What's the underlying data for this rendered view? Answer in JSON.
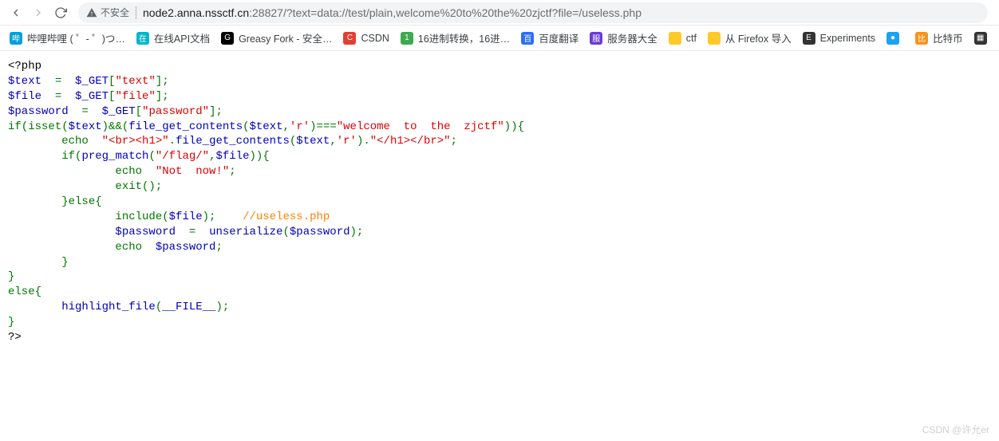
{
  "toolbar": {
    "insecure_label": "不安全",
    "url_host": "node2.anna.nssctf.cn",
    "url_port": ":28827",
    "url_path": "/?text=data://test/plain,welcome%20to%20the%20zjctf?file=/useless.php"
  },
  "bookmarks": [
    {
      "label": "哔哩哔哩 ( ゜- ゜)つ…",
      "color": "#00a1d6"
    },
    {
      "label": "在线API文档",
      "color": "#00b6c8"
    },
    {
      "label": "Greasy Fork - 安全…",
      "color": "#000"
    },
    {
      "label": "CSDN",
      "color": "#e33e33"
    },
    {
      "label": "16进制转换，16进…",
      "color": "#3daa4f"
    },
    {
      "label": "百度翻译",
      "color": "#2d6ff1"
    },
    {
      "label": "服务器大全",
      "color": "#6a3bd9"
    },
    {
      "label": "ctf",
      "folder": true
    },
    {
      "label": "从 Firefox 导入",
      "folder": true
    },
    {
      "label": "Experiments",
      "color": "#333"
    },
    {
      "label": "",
      "color": "#1da1f2"
    },
    {
      "label": "比特币",
      "color": "#f7931a"
    }
  ],
  "code": {
    "l1_open": "<?php",
    "l2_var": "$text",
    "l2_eq": "  =  ",
    "l2_get": "$_GET",
    "l2_br": "[",
    "l2_key": "\"text\"",
    "l2_end": "];",
    "l3_var": "$file",
    "l3_eq": "  =  ",
    "l3_get": "$_GET",
    "l3_br": "[",
    "l3_key": "\"file\"",
    "l3_end": "];",
    "l4_var": "$password",
    "l4_eq": "  =  ",
    "l4_get": "$_GET",
    "l4_br": "[",
    "l4_key": "\"password\"",
    "l4_end": "];",
    "l5_if": "if(",
    "l5_isset": "isset",
    "l5_p": "(",
    "l5_text": "$text",
    "l5_and": ")&&(",
    "l5_fgc": "file_get_contents",
    "l5_p2": "(",
    "l5_text2": "$text",
    "l5_c": ",",
    "l5_r": "'r'",
    "l5_eq": ")===",
    "l5_welcome": "\"welcome  to  the  zjctf\"",
    "l5_end": ")){",
    "l6_echo": "echo  ",
    "l6_s1": "\"<br><h1>\"",
    "l6_dot": ".",
    "l6_fgc": "file_get_contents",
    "l6_p": "(",
    "l6_text": "$text",
    "l6_c": ",",
    "l6_r": "'r'",
    "l6_p2": ").",
    "l6_s2": "\"</h1></br>\"",
    "l6_end": ";",
    "l7_if": "if(",
    "l7_pm": "preg_match",
    "l7_p": "(",
    "l7_pat": "\"/flag/\"",
    "l7_c": ",",
    "l7_file": "$file",
    "l7_end": ")){",
    "l8_echo": "echo  ",
    "l8_s": "\"Not  now!\"",
    "l8_end": ";",
    "l9_exit": "exit",
    "l9_p": "();",
    "l10_else": "}else{",
    "l11_inc": "include",
    "l11_p": "(",
    "l11_file": "$file",
    "l11_p2": ");    ",
    "l11_cmt": "//useless.php",
    "l12_var": "$password",
    "l12_eq": "  =  ",
    "l12_un": "unserialize",
    "l12_p": "(",
    "l12_pw": "$password",
    "l12_end": ");",
    "l13_echo": "echo  ",
    "l13_pw": "$password",
    "l13_end": ";",
    "l14_c": "}",
    "l15_c": "}",
    "l16_else": "else{",
    "l17_hl": "highlight_file",
    "l17_p": "(",
    "l17_f": "__FILE__",
    "l17_end": ");",
    "l18_c": "}",
    "l19_close": "?>"
  },
  "watermark": "CSDN @许允er"
}
